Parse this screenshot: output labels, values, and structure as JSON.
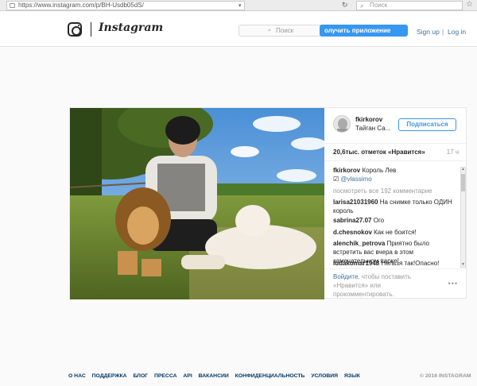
{
  "browser": {
    "url": "https://www.instagram.com/p/BH-Usdb05dS/",
    "search_placeholder": "Поиск"
  },
  "header": {
    "wordmark": "Instagram",
    "search_placeholder": "Поиск",
    "get_app_label": "олучить приложение",
    "signup_label": "Sign up",
    "login_separator": "|",
    "login_label": "Log in"
  },
  "post": {
    "username": "fkirkorov",
    "location": "Тайган Са...",
    "follow_label": "Подписаться",
    "likes": "20,6тыс. отметок «Нравится»",
    "time": "17 ч",
    "caption_user": "fkirkorov",
    "caption_text": "Король Лев",
    "caption_mention": "@vlassimo",
    "view_all": "посмотреть все 192 комментарие",
    "comments": [
      {
        "user": "larisa21031960",
        "text": "На снимке только ОДИН король"
      },
      {
        "user": "sabrina27.07",
        "text": "Ого"
      },
      {
        "user": "d.chesnokov",
        "text": "Как не боится!"
      },
      {
        "user": "alenchik_petrova",
        "text": "Приятно было встретить вас вчера в этом замечательном парке!"
      },
      {
        "user": "ludakomar1948",
        "text": "Нельзя так!Опасно!"
      }
    ],
    "login_link": "Войдите",
    "login_text": ", чтобы поставить «Нравится» или прокомментировать.",
    "more_icon": "more-options-icon"
  },
  "footer": {
    "links": [
      "О НАС",
      "ПОДДЕРЖКА",
      "БЛОГ",
      "ПРЕССА",
      "API",
      "ВАКАНСИИ",
      "КОНФИДЕНЦИАЛЬНОСТЬ",
      "УСЛОВИЯ",
      "ЯЗЫК"
    ],
    "copyright": "© 2016 INSTAGRAM"
  },
  "colors": {
    "accent": "#3897f0",
    "link": "#3f729b",
    "footer_link": "#003569"
  }
}
